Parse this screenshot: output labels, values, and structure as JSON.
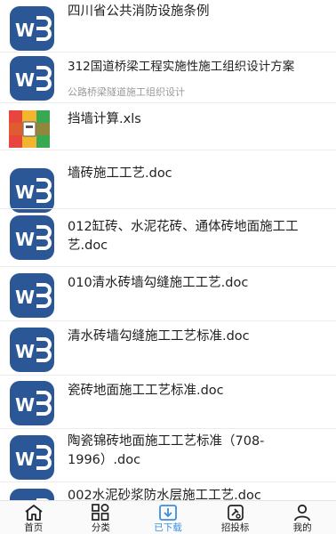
{
  "files": [
    {
      "icon": "word-doc-icon",
      "title": "四川省公共消防设施条例",
      "subtitle": ""
    },
    {
      "icon": "word-doc-icon",
      "title": "312国道桥梁工程实施性施工组织设计方案",
      "subtitle": "公路桥梁隧道施工组织设计"
    },
    {
      "icon": "archive-file-icon",
      "title": "挡墙计算.xls",
      "subtitle": ""
    },
    {
      "icon": "word-doc-icon",
      "title": "墙砖施工工艺.doc",
      "subtitle": ""
    },
    {
      "icon": "word-doc-icon",
      "title": "012缸砖、水泥花砖、通体砖地面施工工艺.doc",
      "subtitle": ""
    },
    {
      "icon": "word-doc-icon",
      "title": "010清水砖墙勾缝施工工艺.doc",
      "subtitle": ""
    },
    {
      "icon": "word-doc-icon",
      "title": "清水砖墙勾缝施工工艺标准.doc",
      "subtitle": ""
    },
    {
      "icon": "word-doc-icon",
      "title": "瓷砖地面施工工艺标准.doc",
      "subtitle": ""
    },
    {
      "icon": "word-doc-icon",
      "title": "陶瓷锦砖地面施工工艺标准（708-1996）.doc",
      "subtitle": ""
    },
    {
      "icon": "word-doc-icon",
      "title": "002水泥砂浆防水层施工工艺.doc",
      "subtitle": ""
    }
  ],
  "tabs": [
    {
      "label": "首页",
      "icon": "home-icon",
      "active": false
    },
    {
      "label": "分类",
      "icon": "category-grid-icon",
      "active": false
    },
    {
      "label": "已下载",
      "icon": "download-icon",
      "active": true
    },
    {
      "label": "招投标",
      "icon": "bidding-icon",
      "active": false
    },
    {
      "label": "我的",
      "icon": "profile-icon",
      "active": false
    }
  ],
  "colors": {
    "word_blue": "#2b5797",
    "active_tab": "#3a8fe0",
    "archive_red": "#e8453c",
    "archive_yellow": "#f3b52e",
    "archive_green": "#38a852",
    "archive_blue": "#3d86e0"
  }
}
